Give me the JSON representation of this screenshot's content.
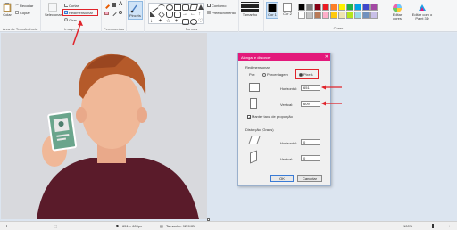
{
  "ribbon": {
    "clipboard": {
      "paste_label": "Colar",
      "cut_label": "Recortar",
      "copy_label": "Copiar",
      "group_label": "Área de Transferência"
    },
    "image": {
      "select_label": "Selecionar",
      "crop_label": "Cortar",
      "resize_label": "Redimensionar",
      "rotate_label": "Girar",
      "group_label": "Imagem"
    },
    "tools": {
      "group_label": "Ferramentas"
    },
    "brushes": {
      "label": "Pincéis"
    },
    "shapes": {
      "outline_label": "Contorno",
      "fill_label": "Preenchimento",
      "group_label": "Formas"
    },
    "size": {
      "label": "Tamanho"
    },
    "color1": {
      "label": "Cor 1"
    },
    "color2": {
      "label": "Cor 2"
    },
    "colors": {
      "group_label": "Cores",
      "swatches": [
        "#000000",
        "#7f7f7f",
        "#880015",
        "#ed1c24",
        "#ff7f27",
        "#fff200",
        "#22b14c",
        "#00a2e8",
        "#3f48cc",
        "#a349a4",
        "#ffffff",
        "#c3c3c3",
        "#b97a57",
        "#ffaec9",
        "#ffc90e",
        "#efe4b0",
        "#b5e61d",
        "#99d9ea",
        "#7092be",
        "#c8bfe7"
      ],
      "edit_label": "Editar cores",
      "paint3d_label": "Editar com o Paint 3D"
    }
  },
  "dialog": {
    "title": "Alongar e distorcer",
    "resize_heading": "Redimensionar",
    "by_label": "Por:",
    "percent_label": "Porcentagem",
    "pixels_label": "Pixels",
    "horizontal_label": "Horizontal:",
    "horizontal_value": "651",
    "vertical_label": "Vertical:",
    "vertical_value": "609",
    "keep_ratio_label": "Manter taxa de proporção",
    "skew_heading": "Distorção (Graus)",
    "skew_horizontal_label": "Horizontal:",
    "skew_horizontal_value": "0",
    "skew_vertical_label": "Vertical:",
    "skew_vertical_value": "0",
    "ok_label": "OK",
    "cancel_label": "Cancelar"
  },
  "status": {
    "dimensions": "651 × 609px",
    "size": "Tamanho: 92,9KB",
    "zoom": "100%"
  },
  "colors": {
    "accent": "#e3197b",
    "highlight": "#e0242b"
  }
}
